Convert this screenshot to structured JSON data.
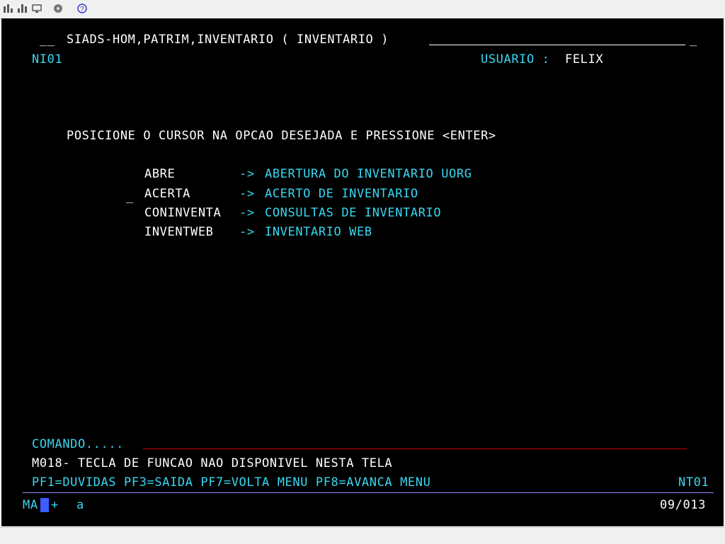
{
  "toolbar": {
    "icons": [
      "bars-icon",
      "bars-alt-icon",
      "monitor-icon",
      "disk-icon",
      "help-icon"
    ]
  },
  "screen": {
    "title_prefix": "__",
    "title": "SIADS-HOM,PATRIM,INVENTARIO ( INVENTARIO )",
    "title_suffix": "_",
    "screen_id": "NI01",
    "user_label": "USUARIO :",
    "user_name": "FELIX",
    "instruction": "POSICIONE O CURSOR NA OPCAO DESEJADA E PRESSIONE <ENTER>",
    "options": [
      {
        "code": "ABRE",
        "arrow": "->",
        "desc": "ABERTURA DO INVENTARIO UORG"
      },
      {
        "code": "ACERTA",
        "arrow": "->",
        "desc": "ACERTO DE INVENTARIO"
      },
      {
        "code": "CONINVENTA",
        "arrow": "->",
        "desc": "CONSULTAS DE INVENTARIO"
      },
      {
        "code": "INVENTWEB",
        "arrow": "->",
        "desc": "INVENTARIO WEB"
      }
    ],
    "cursor_mark": "_",
    "command_label": "COMANDO.....",
    "message": "M018- TECLA DE FUNCAO NAO DISPONIVEL NESTA TELA",
    "pf_keys": "PF1=DUVIDAS PF3=SAIDA PF7=VOLTA MENU PF8=AVANCA MENU",
    "screen_code": "NT01"
  },
  "status": {
    "mode_ma": "MA",
    "plus": "+",
    "letter": "a",
    "position": "09/013"
  },
  "colors": {
    "background": "#000000",
    "white_text": "#ffffff",
    "cyan_text": "#38d7f0",
    "command_line": "#c80000",
    "status_line": "#8a8aff"
  }
}
